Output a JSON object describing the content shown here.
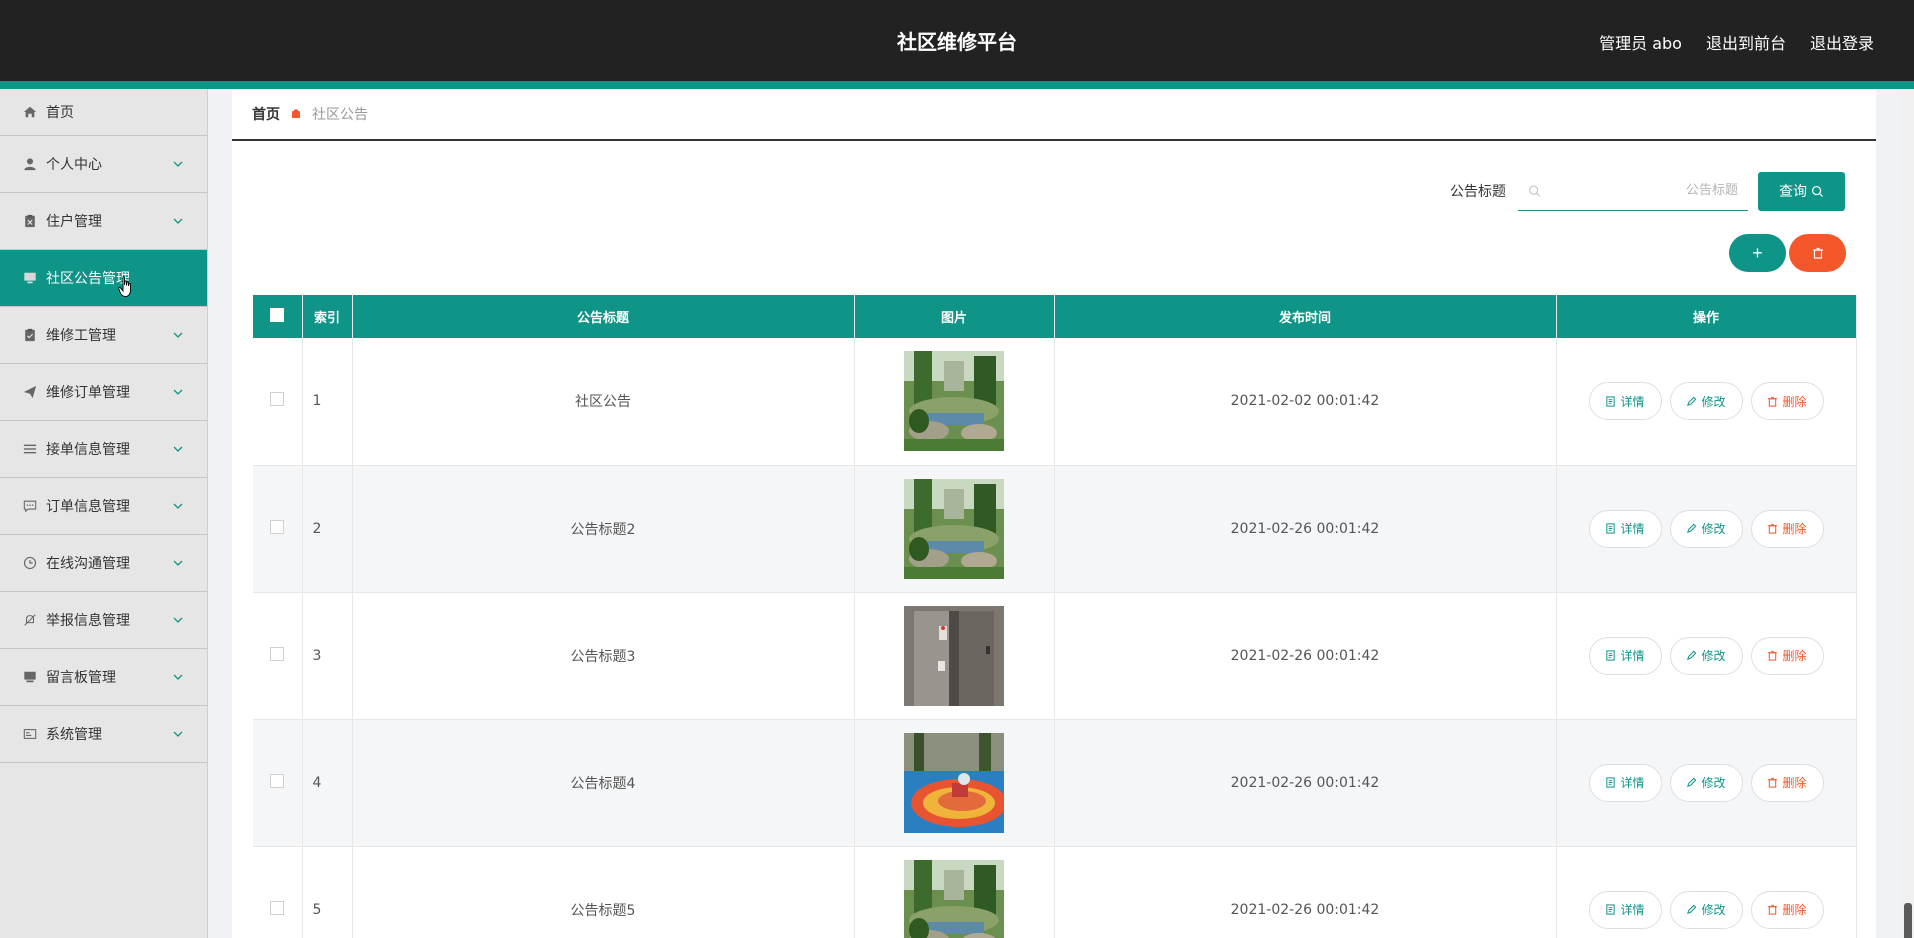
{
  "header": {
    "title": "社区维修平台",
    "user": "管理员 abo",
    "to_front": "退出到前台",
    "logout": "退出登录"
  },
  "sidebar": {
    "items": [
      {
        "label": "首页",
        "icon": "home-icon",
        "has_chevron": false
      },
      {
        "label": "个人中心",
        "icon": "user-icon",
        "has_chevron": true
      },
      {
        "label": "住户管理",
        "icon": "clipboard-x-icon",
        "has_chevron": true
      },
      {
        "label": "社区公告管理",
        "icon": "monitor-icon",
        "has_chevron": false,
        "active": true
      },
      {
        "label": "维修工管理",
        "icon": "clipboard-check-icon",
        "has_chevron": true
      },
      {
        "label": "维修订单管理",
        "icon": "send-icon",
        "has_chevron": true
      },
      {
        "label": "接单信息管理",
        "icon": "list-icon",
        "has_chevron": true
      },
      {
        "label": "订单信息管理",
        "icon": "chat-icon",
        "has_chevron": true
      },
      {
        "label": "在线沟通管理",
        "icon": "clock-icon",
        "has_chevron": true
      },
      {
        "label": "举报信息管理",
        "icon": "bell-off-icon",
        "has_chevron": true
      },
      {
        "label": "留言板管理",
        "icon": "board-icon",
        "has_chevron": true
      },
      {
        "label": "系统管理",
        "icon": "id-card-icon",
        "has_chevron": true
      }
    ]
  },
  "breadcrumb": {
    "home": "首页",
    "current": "社区公告"
  },
  "search": {
    "label": "公告标题",
    "placeholder": "公告标题",
    "button": "查询"
  },
  "actions": {
    "add_label": "+"
  },
  "table": {
    "headers": {
      "index": "索引",
      "title": "公告标题",
      "image": "图片",
      "time": "发布时间",
      "ops": "操作"
    },
    "op_labels": {
      "detail": "详情",
      "edit": "修改",
      "delete": "删除"
    },
    "rows": [
      {
        "index": "1",
        "title": "社区公告",
        "time": "2021-02-02 00:01:42",
        "image": "garden"
      },
      {
        "index": "2",
        "title": "公告标题2",
        "time": "2021-02-26 00:01:42",
        "image": "garden"
      },
      {
        "index": "3",
        "title": "公告标题3",
        "time": "2021-02-26 00:01:42",
        "image": "elevator"
      },
      {
        "index": "4",
        "title": "公告标题4",
        "time": "2021-02-26 00:01:42",
        "image": "playground"
      },
      {
        "index": "5",
        "title": "公告标题5",
        "time": "2021-02-26 00:01:42",
        "image": "garden"
      }
    ]
  },
  "colors": {
    "accent": "#0f9488",
    "danger": "#f4572a",
    "topbar": "#222222"
  }
}
